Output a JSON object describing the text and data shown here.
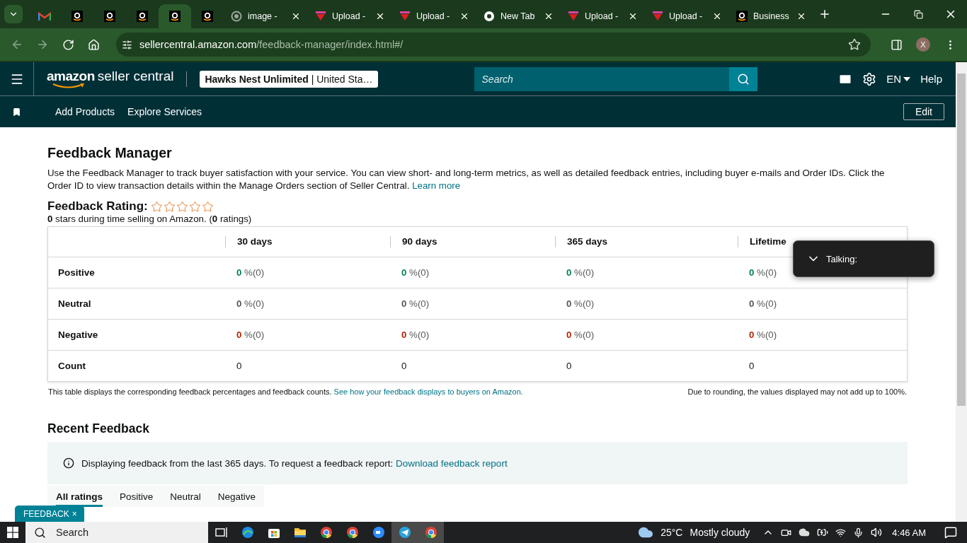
{
  "browser": {
    "tabs": [
      {
        "kind": "gmail",
        "selected": false
      },
      {
        "kind": "amazon",
        "selected": false
      },
      {
        "kind": "amazon",
        "selected": false
      },
      {
        "kind": "amazon",
        "selected": false
      },
      {
        "kind": "amazon",
        "selected": true
      },
      {
        "kind": "amazon",
        "selected": false
      },
      {
        "kind": "loading",
        "title": "image -",
        "selected": false
      },
      {
        "kind": "upload",
        "title": "Upload -",
        "selected": false
      },
      {
        "kind": "upload",
        "title": "Upload -",
        "selected": false
      },
      {
        "kind": "chrome",
        "title": "New Tab",
        "selected": false
      },
      {
        "kind": "upload",
        "title": "Upload -",
        "selected": false
      },
      {
        "kind": "upload",
        "title": "Upload -",
        "selected": false
      },
      {
        "kind": "amazon",
        "title": "Business",
        "selected": false
      }
    ],
    "url_host": "sellercentral.amazon.com",
    "url_path": "/feedback-manager/index.html#/",
    "profile": "X"
  },
  "header": {
    "logo_brand": "amazon",
    "logo_product": "seller central",
    "store_name": "Hawks Nest Unlimited",
    "store_separator": "|",
    "store_region": "United Sta…",
    "search_placeholder": "Search",
    "language": "EN",
    "help": "Help"
  },
  "subnav": {
    "links": [
      "Add Products",
      "Explore Services"
    ],
    "edit": "Edit"
  },
  "page": {
    "title": "Feedback Manager",
    "description": "Use the Feedback Manager to track buyer satisfaction with your service. You can view short- and long-term metrics, as well as detailed feedback entries, including buyer e-mails and Order IDs. Click the Order ID to view transaction details within the Manage Orders section of Seller Central.",
    "learn_more": "Learn more",
    "rating_label": "Feedback Rating:",
    "stars": 0,
    "rating_summary": "**0** stars during time selling on Amazon. (**0** ratings)",
    "table": {
      "columns": [
        "30 days",
        "90 days",
        "365 days",
        "Lifetime"
      ],
      "rows": [
        {
          "kind": "positive",
          "label": "Positive",
          "cells": [
            {
              "value": "0",
              "suffix": "%(0)"
            },
            {
              "value": "0",
              "suffix": "%(0)"
            },
            {
              "value": "0",
              "suffix": "%(0)"
            },
            {
              "value": "0",
              "suffix": "%(0)"
            }
          ]
        },
        {
          "kind": "neutral",
          "label": "Neutral",
          "cells": [
            {
              "value": "0",
              "suffix": "%(0)"
            },
            {
              "value": "0",
              "suffix": "%(0)"
            },
            {
              "value": "0",
              "suffix": "%(0)"
            },
            {
              "value": "0",
              "suffix": "%(0)"
            }
          ]
        },
        {
          "kind": "negative",
          "label": "Negative",
          "cells": [
            {
              "value": "0",
              "suffix": "%(0)"
            },
            {
              "value": "0",
              "suffix": "%(0)"
            },
            {
              "value": "0",
              "suffix": "%(0)"
            },
            {
              "value": "0",
              "suffix": "%(0)"
            }
          ]
        },
        {
          "kind": "count",
          "label": "Count",
          "cells": [
            {
              "value": "0"
            },
            {
              "value": "0"
            },
            {
              "value": "0"
            },
            {
              "value": "0"
            }
          ]
        }
      ]
    },
    "table_note": "This table displays the corresponding feedback percentages and feedback counts.",
    "table_note_link": "See how your feedback displays to buyers on Amazon.",
    "rounding_note": "Due to rounding, the values displayed may not add up to 100%.",
    "recent_title": "Recent Feedback",
    "info_text": "Displaying feedback from the last 365 days. To request a feedback report:",
    "info_link": "Download feedback report",
    "filter_tabs": [
      {
        "label": "All ratings",
        "selected": true
      },
      {
        "label": "Positive",
        "selected": false
      },
      {
        "label": "Neutral",
        "selected": false
      },
      {
        "label": "Negative",
        "selected": false
      }
    ]
  },
  "talking_popup": {
    "label": "Talking:"
  },
  "feedback_button": {
    "label": "FEEDBACK",
    "close": "×"
  },
  "taskbar": {
    "search": "Search",
    "apps": [
      {
        "kind": "taskview",
        "active": false
      },
      {
        "kind": "edge",
        "active": false
      },
      {
        "kind": "store",
        "active": false
      },
      {
        "kind": "folder",
        "active": false
      },
      {
        "kind": "chrome",
        "active": false
      },
      {
        "kind": "chrome",
        "active": false
      },
      {
        "kind": "zoom",
        "active": false
      },
      {
        "kind": "telegram",
        "active": true
      },
      {
        "kind": "chrome",
        "active": true
      }
    ],
    "temperature": "25°C",
    "weather": "Mostly cloudy",
    "time": "4:46 AM"
  }
}
